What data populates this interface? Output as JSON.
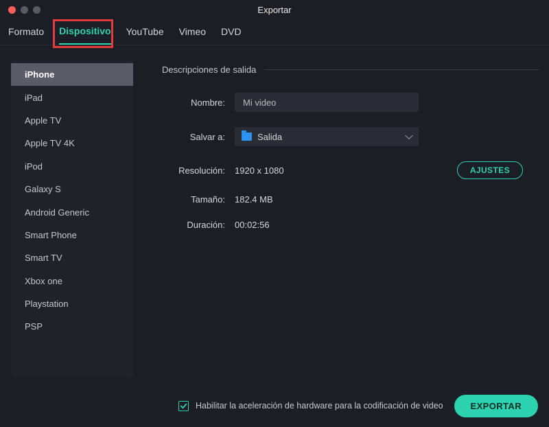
{
  "window": {
    "title": "Exportar"
  },
  "tabs": [
    {
      "label": "Formato"
    },
    {
      "label": "Dispositivo",
      "active": true
    },
    {
      "label": "YouTube"
    },
    {
      "label": "Vimeo"
    },
    {
      "label": "DVD"
    }
  ],
  "sidebar": {
    "items": [
      {
        "label": "iPhone",
        "selected": true
      },
      {
        "label": "iPad"
      },
      {
        "label": "Apple TV"
      },
      {
        "label": "Apple TV 4K"
      },
      {
        "label": "iPod"
      },
      {
        "label": "Galaxy S"
      },
      {
        "label": "Android Generic"
      },
      {
        "label": "Smart Phone"
      },
      {
        "label": "Smart TV"
      },
      {
        "label": "Xbox one"
      },
      {
        "label": "Playstation"
      },
      {
        "label": "PSP"
      }
    ]
  },
  "main": {
    "section_title": "Descripciones de salida",
    "name_label": "Nombre:",
    "name_value": "Mi video",
    "save_label": "Salvar a:",
    "save_folder": "Salida",
    "resolution_label": "Resolución:",
    "resolution_value": "1920 x 1080",
    "settings_btn": "AJUSTES",
    "size_label": "Tamaño:",
    "size_value": "182.4 MB",
    "duration_label": "Duración:",
    "duration_value": "00:02:56"
  },
  "footer": {
    "hw_accel_label": "Habilitar la aceleración de hardware para la codificación de video",
    "hw_accel_checked": true,
    "export_btn": "EXPORTAR"
  }
}
